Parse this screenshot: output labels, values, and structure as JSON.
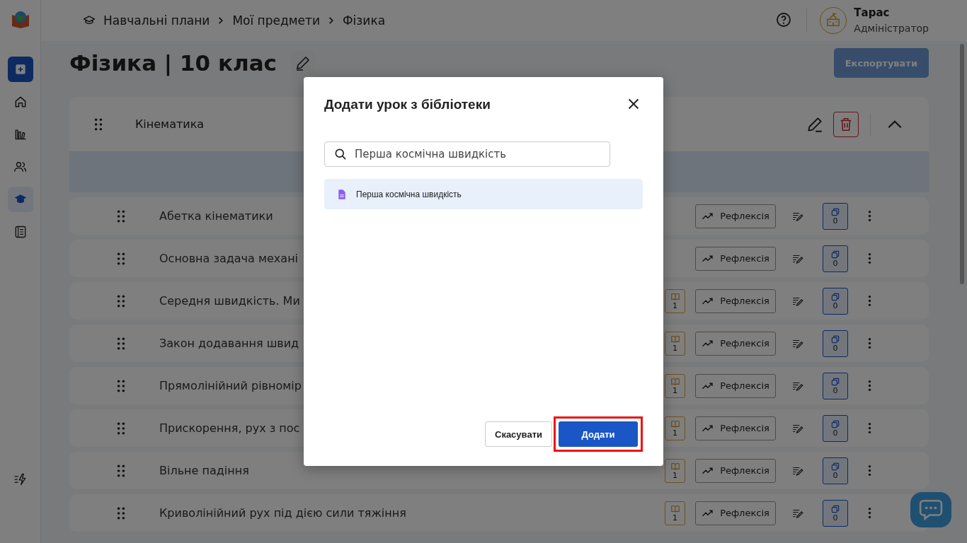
{
  "sidebar": {
    "items": [
      {
        "kind": "add",
        "selected": false
      },
      {
        "kind": "home",
        "selected": false
      },
      {
        "kind": "stats",
        "selected": false
      },
      {
        "kind": "users",
        "selected": false
      },
      {
        "kind": "courses",
        "selected": true
      },
      {
        "kind": "journal",
        "selected": false
      }
    ],
    "bottom": {
      "kind": "quick"
    }
  },
  "breadcrumb": [
    "Навчальні плани",
    "Мої предмети",
    "Фізика"
  ],
  "user": {
    "name": "Тарас",
    "role": "Адміністратор"
  },
  "page": {
    "title": "Фізика | 10 клас",
    "export": {
      "label": "Експортувати",
      "disabled": true
    }
  },
  "section": {
    "title": "Кінематика",
    "expanded": true
  },
  "lessons": [
    {
      "title": "Абетка кінематики",
      "reflection": "Рефлексія",
      "copies": "0"
    },
    {
      "title": "Основна задача механі",
      "reflection": "Рефлексія",
      "copies": "0"
    },
    {
      "title": "Середня швидкість. Ми",
      "books": "1",
      "reflection": "Рефлексія",
      "copies": "0"
    },
    {
      "title": "Закон додавання швид",
      "books": "1",
      "reflection": "Рефлексія",
      "copies": "0"
    },
    {
      "title": "Прямолінійний рівномір",
      "books": "1",
      "reflection": "Рефлексія",
      "copies": "0"
    },
    {
      "title": "Прискорення, рух з пос",
      "books": "1",
      "reflection": "Рефлексія",
      "copies": "0"
    },
    {
      "title": "Вільне падіння",
      "books": "1",
      "reflection": "Рефлексія",
      "copies": "0"
    },
    {
      "title": "Криволінійний рух під дією сили тяжіння",
      "books": "1",
      "reflection": "Рефлексія",
      "copies": "0"
    }
  ],
  "dialog": {
    "title": "Додати урок з бібліотеки",
    "search": {
      "value": "Перша космічна швидкість"
    },
    "results": [
      {
        "title": "Перша космічна швидкість",
        "selected": true
      }
    ],
    "cancel": "Скасувати",
    "confirm": {
      "label": "Додати",
      "highlighted": true
    }
  }
}
